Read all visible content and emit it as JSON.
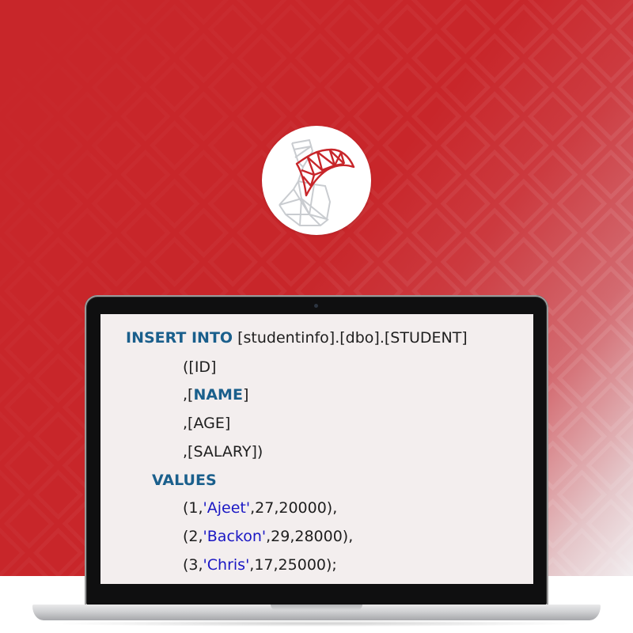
{
  "background": {
    "primary_color": "#c8262a",
    "pattern": "diamond-chevron",
    "fade_color": "#f2eef0"
  },
  "logo": {
    "icon": "sql-server-logo-icon",
    "accent": "#c8262a",
    "secondary": "#c9ccd0"
  },
  "code": {
    "keyword_color": "#1a5f8c",
    "string_color": "#1a17c4",
    "line1": {
      "kw": "INSERT INTO",
      "rest": " [studentinfo].[dbo].[STUDENT]"
    },
    "line2": {
      "text": "([ID]"
    },
    "line3": {
      "pre": ",[",
      "kw": "NAME",
      "post": "]"
    },
    "line4": {
      "text": ",[AGE]"
    },
    "line5": {
      "text": ",[SALARY])"
    },
    "line6": {
      "kw": "VALUES"
    },
    "rows": [
      {
        "open": "(1,",
        "name": "'Ajeet'",
        "rest": ",27,20000),"
      },
      {
        "open": "(2,",
        "name": "'Backon'",
        "rest": ",29,28000),"
      },
      {
        "open": "(3,",
        "name": "'Chris'",
        "rest": ",17,25000);"
      }
    ]
  }
}
